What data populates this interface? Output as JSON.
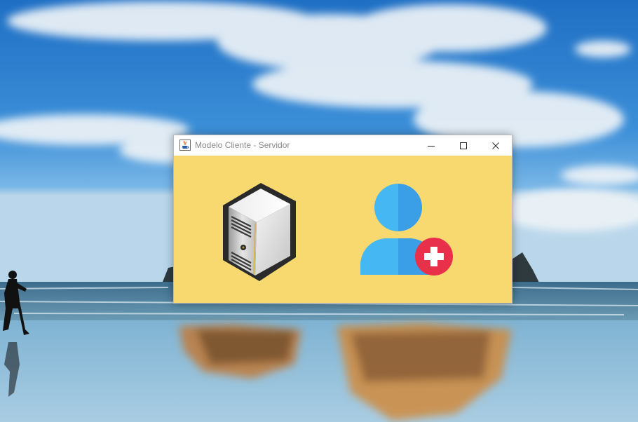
{
  "window": {
    "title": "Modelo Cliente - Servidor",
    "background_color": "#f8d970"
  },
  "titlebar": {
    "app_icon": "java-cup-icon",
    "minimize_icon": "minimize-icon",
    "maximize_icon": "maximize-icon",
    "close_icon": "close-icon"
  },
  "content": {
    "server_button": {
      "icon": "server-tower-icon"
    },
    "client_button": {
      "icon": "add-user-icon",
      "colors": {
        "user": "#3fa9f0",
        "plus_badge": "#e8304a"
      }
    }
  },
  "desktop": {
    "wallpaper": "beach-sky-runner"
  }
}
